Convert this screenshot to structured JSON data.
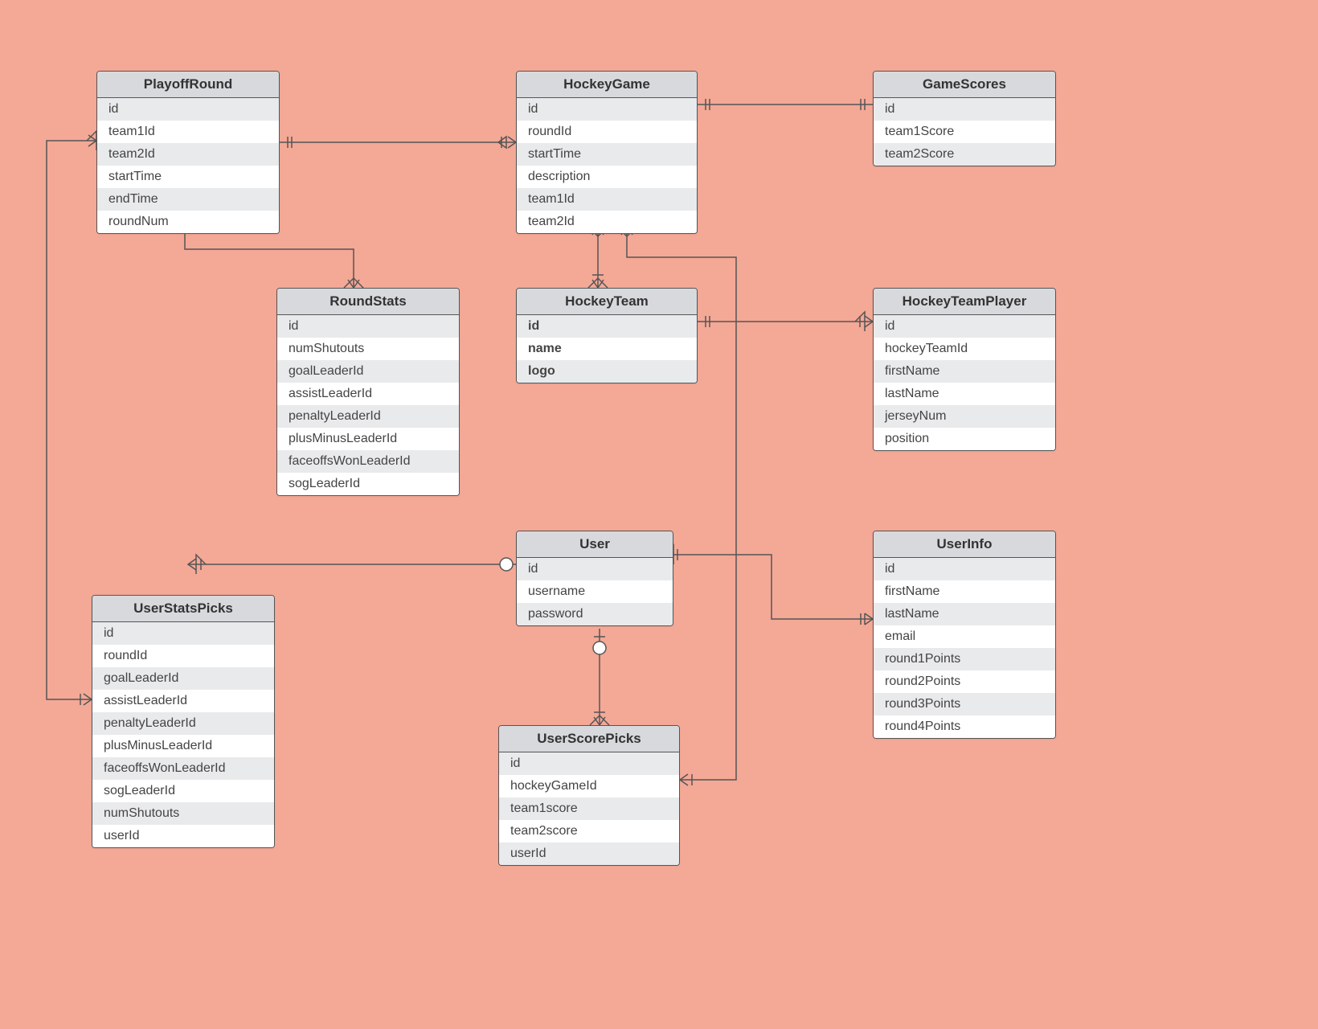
{
  "entities": {
    "playoffRound": {
      "name": "PlayoffRound",
      "fields": [
        "id",
        "team1Id",
        "team2Id",
        "startTime",
        "endTime",
        "roundNum"
      ]
    },
    "hockeyGame": {
      "name": "HockeyGame",
      "fields": [
        "id",
        "roundId",
        "startTime",
        "description",
        "team1Id",
        "team2Id"
      ]
    },
    "gameScores": {
      "name": "GameScores",
      "fields": [
        "id",
        "team1Score",
        "team2Score"
      ]
    },
    "roundStats": {
      "name": "RoundStats",
      "fields": [
        "id",
        "numShutouts",
        "goalLeaderId",
        "assistLeaderId",
        "penaltyLeaderId",
        "plusMinusLeaderId",
        "faceoffsWonLeaderId",
        "sogLeaderId"
      ]
    },
    "hockeyTeam": {
      "name": "HockeyTeam",
      "fields": [
        "id",
        "name",
        "logo"
      ],
      "bold": true
    },
    "hockeyTeamPlayer": {
      "name": "HockeyTeamPlayer",
      "fields": [
        "id",
        "hockeyTeamId",
        "firstName",
        "lastName",
        "jerseyNum",
        "position"
      ]
    },
    "user": {
      "name": "User",
      "fields": [
        "id",
        "username",
        "password"
      ]
    },
    "userInfo": {
      "name": "UserInfo",
      "fields": [
        "id",
        "firstName",
        "lastName",
        "email",
        "round1Points",
        "round2Points",
        "round3Points",
        "round4Points"
      ]
    },
    "userStatsPicks": {
      "name": "UserStatsPicks",
      "fields": [
        "id",
        "roundId",
        "goalLeaderId",
        "assistLeaderId",
        "penaltyLeaderId",
        "plusMinusLeaderId",
        "faceoffsWonLeaderId",
        "sogLeaderId",
        "numShutouts",
        "userId"
      ]
    },
    "userScorePicks": {
      "name": "UserScorePicks",
      "fields": [
        "id",
        "hockeyGameId",
        "team1score",
        "team2score",
        "userId"
      ]
    }
  }
}
